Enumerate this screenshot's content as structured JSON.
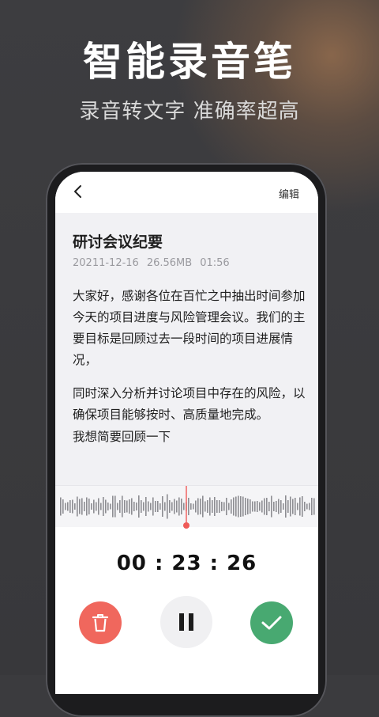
{
  "hero": {
    "title": "智能录音笔",
    "subtitle": "录音转文字 准确率超高"
  },
  "topbar": {
    "back_icon": "chevron-left-icon",
    "edit_label": "编辑"
  },
  "note": {
    "title": "研讨会议纪要",
    "date": "20211-12-16",
    "size": "26.56MB",
    "duration": "01:56",
    "paragraph1": "大家好，感谢各位在百忙之中抽出时间参加今天的项目进度与风险管理会议。我们的主要目标是回顾过去一段时间的项目进展情况，",
    "paragraph2": "同时深入分析并讨论项目中存在的风险，以确保项目能够按时、高质量地完成。",
    "paragraph3": "我想简要回顾一下"
  },
  "recorder": {
    "elapsed": "00 : 23 : 26",
    "delete_icon": "trash-icon",
    "pause_icon": "pause-icon",
    "done_icon": "check-icon",
    "colors": {
      "delete": "#f0675d",
      "done": "#48a971",
      "playhead": "#ef5a58"
    }
  }
}
